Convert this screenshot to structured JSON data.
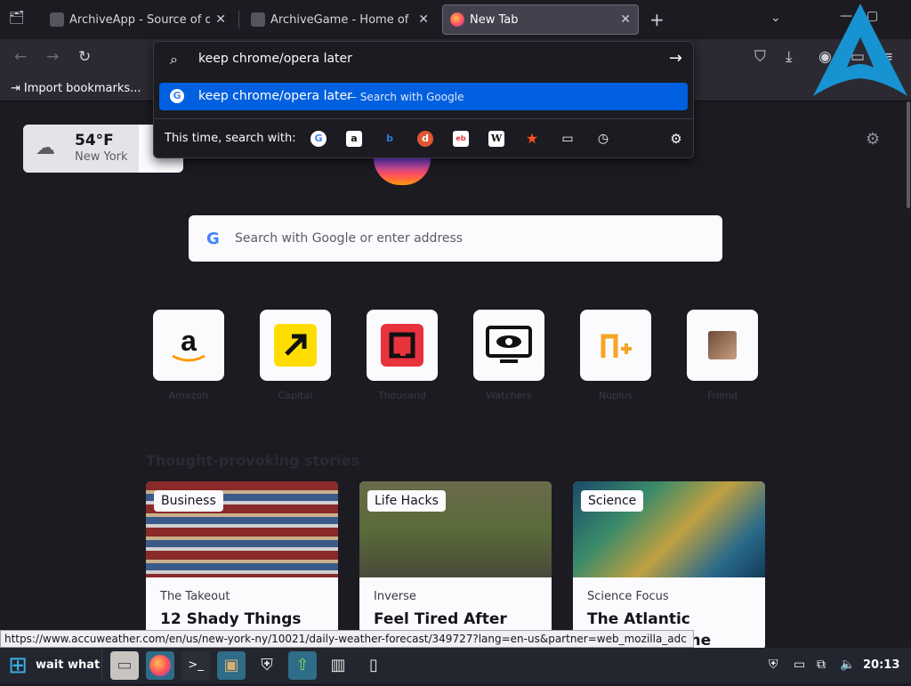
{
  "tabs": [
    {
      "title": "ArchiveApp - Source of digi",
      "active": false
    },
    {
      "title": "ArchiveGame - Home of digi",
      "active": false
    },
    {
      "title": "New Tab",
      "active": true
    }
  ],
  "urlbar": {
    "value": "keep chrome/opera later",
    "suggestion": "keep chrome/opera later",
    "suggestion_hint": "— Search with Google",
    "oneoff_label": "This time, search with:",
    "engines": [
      "google-icon",
      "amazon-icon",
      "bing-icon",
      "duckduckgo-icon",
      "ebay-icon",
      "wikipedia-icon",
      "bookmarks-icon",
      "tabs-icon",
      "history-icon",
      "settings-icon"
    ]
  },
  "bookmarks": {
    "import_label": "Import bookmarks..."
  },
  "weather": {
    "temp": "54°F",
    "city": "New York"
  },
  "search": {
    "placeholder": "Search with Google or enter address"
  },
  "topsites": [
    {
      "label": "Amazon"
    },
    {
      "label": "Capital"
    },
    {
      "label": "Thousand"
    },
    {
      "label": "Watchers"
    },
    {
      "label": "Nuplus"
    },
    {
      "label": "Friend"
    }
  ],
  "stories": {
    "title": "Thought-provoking stories",
    "cards": [
      {
        "tag": "Business",
        "source": "The Takeout",
        "headline": "12 Shady Things"
      },
      {
        "tag": "Life Hacks",
        "source": "Inverse",
        "headline": "Feel Tired After"
      },
      {
        "tag": "Science",
        "source": "Science Focus",
        "headline": "The Atlantic Ocean’s ... the"
      }
    ]
  },
  "status_url": "https://www.accuweather.com/en/us/new-york-ny/10021/daily-weather-forecast/349727?lang=en-us&partner=web_mozilla_adc",
  "taskbar": {
    "task_label": "wait what",
    "clock": "20:13"
  }
}
